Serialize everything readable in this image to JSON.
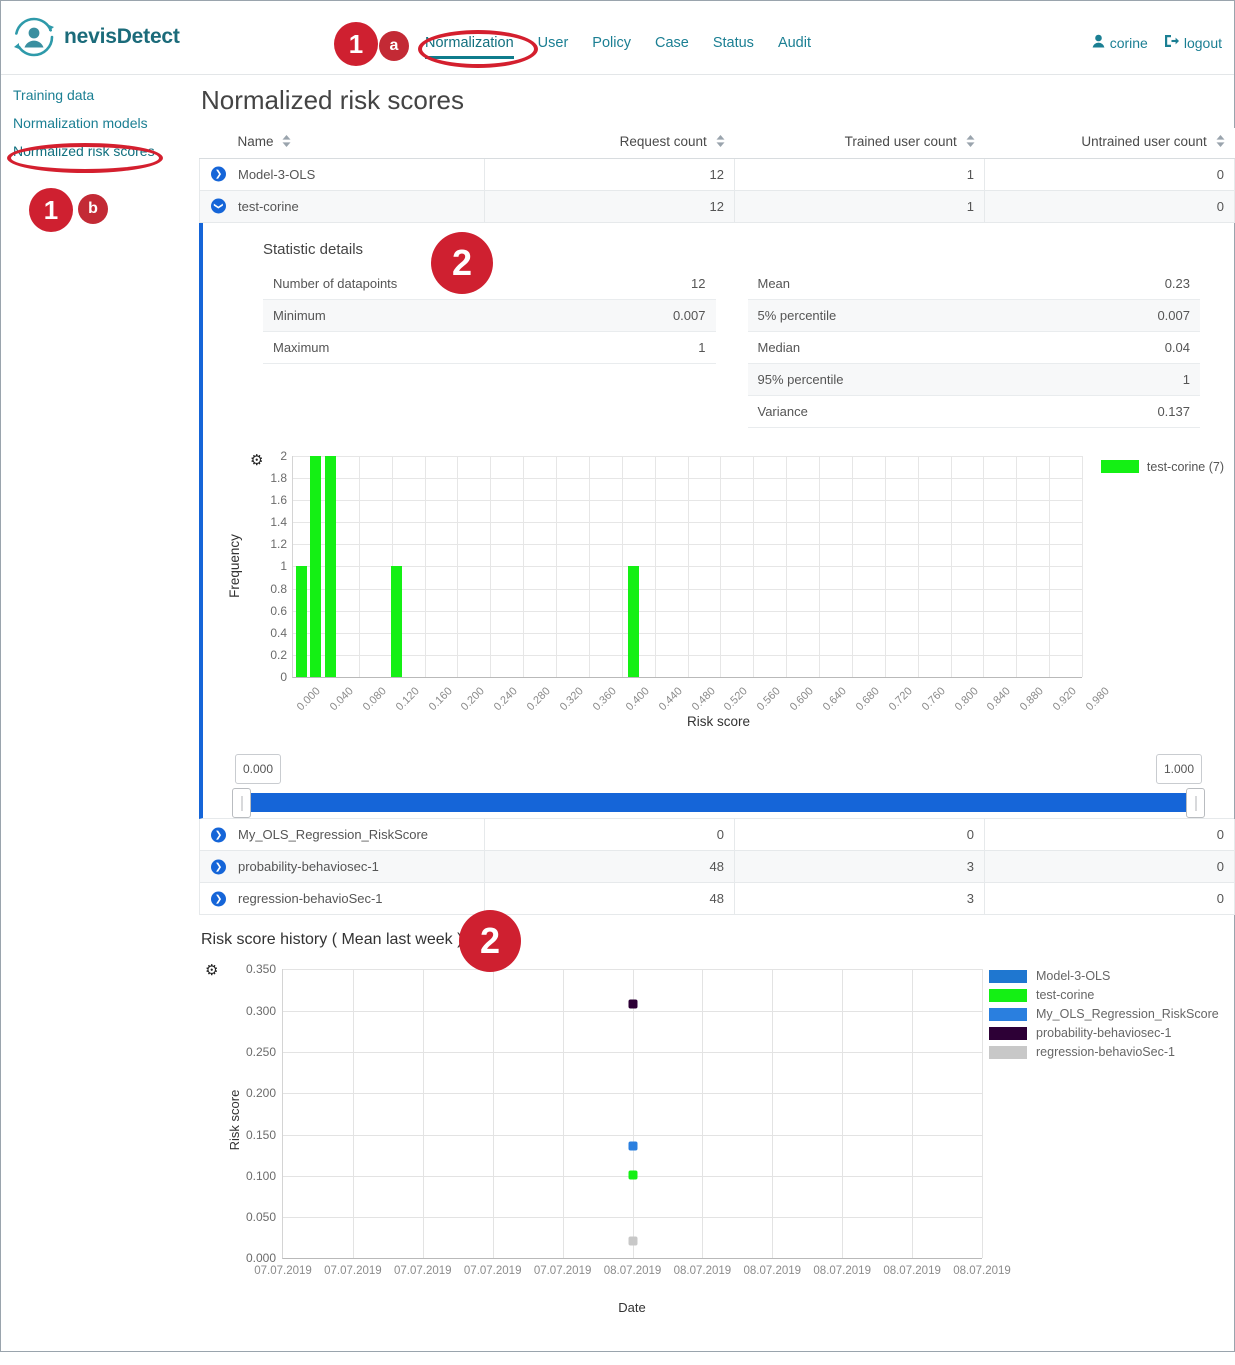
{
  "brand": {
    "name": "nevisDetect",
    "logo_icon": "user-circle-arrows-logo"
  },
  "topnav": {
    "items": [
      {
        "label": "Normalization",
        "active": true
      },
      {
        "label": "User",
        "active": false
      },
      {
        "label": "Policy",
        "active": false
      },
      {
        "label": "Case",
        "active": false
      },
      {
        "label": "Status",
        "active": false
      },
      {
        "label": "Audit",
        "active": false
      }
    ],
    "user": {
      "name": "corine",
      "icon": "user-icon"
    },
    "logout": {
      "label": "logout",
      "icon": "logout-icon"
    }
  },
  "sidebar": {
    "items": [
      {
        "label": "Training data",
        "active": false
      },
      {
        "label": "Normalization models",
        "active": false
      },
      {
        "label": "Normalized risk scores",
        "active": true
      }
    ]
  },
  "page": {
    "title": "Normalized risk scores"
  },
  "table": {
    "headers": [
      "Name",
      "Request count",
      "Trained user count",
      "Untrained user count"
    ],
    "rows": [
      {
        "name": "Model-3-OLS",
        "request_count": "12",
        "trained_user_count": "1",
        "untrained_user_count": "0",
        "expanded": false
      },
      {
        "name": "test-corine",
        "request_count": "12",
        "trained_user_count": "1",
        "untrained_user_count": "0",
        "expanded": true
      },
      {
        "name": "My_OLS_Regression_RiskScore",
        "request_count": "0",
        "trained_user_count": "0",
        "untrained_user_count": "0",
        "expanded": false
      },
      {
        "name": "probability-behaviosec-1",
        "request_count": "48",
        "trained_user_count": "3",
        "untrained_user_count": "0",
        "expanded": false
      },
      {
        "name": "regression-behavioSec-1",
        "request_count": "48",
        "trained_user_count": "3",
        "untrained_user_count": "0",
        "expanded": false
      }
    ]
  },
  "detail": {
    "title": "Statistic details",
    "left_stats": [
      {
        "key": "Number of datapoints",
        "value": "12"
      },
      {
        "key": "Minimum",
        "value": "0.007"
      },
      {
        "key": "Maximum",
        "value": "1"
      }
    ],
    "right_stats": [
      {
        "key": "Mean",
        "value": "0.23"
      },
      {
        "key": "5% percentile",
        "value": "0.007"
      },
      {
        "key": "Median",
        "value": "0.04"
      },
      {
        "key": "95% percentile",
        "value": "1"
      },
      {
        "key": "Variance",
        "value": "0.137"
      }
    ],
    "slider": {
      "min_value": "0.000",
      "max_value": "1.000"
    },
    "gear_icon": "gear-icon"
  },
  "history": {
    "title": "Risk score history ( Mean last week )",
    "gear_icon": "gear-icon"
  },
  "annotations": [
    {
      "label": "1",
      "kind": "big"
    },
    {
      "label": "a",
      "kind": "sm"
    },
    {
      "label": "1",
      "kind": "big"
    },
    {
      "label": "b",
      "kind": "sm"
    },
    {
      "label": "2",
      "kind": "huge"
    },
    {
      "label": "2",
      "kind": "huge"
    }
  ],
  "colors": {
    "brand_teal": "#1b7f93",
    "accent_blue": "#1565d8",
    "annotation_red": "#cf2030",
    "series_green": "#14f014",
    "series_blue": "#1f77d0",
    "series_purple": "#2d0036",
    "series_gray": "#c8c8c8"
  },
  "chart_data": [
    {
      "type": "bar",
      "title": "",
      "xlabel": "Risk score",
      "ylabel": "Frequency",
      "legend": [
        {
          "name": "test-corine (7)",
          "color": "#14f014"
        }
      ],
      "legend_position": "right",
      "grid": true,
      "xlim": [
        0.0,
        1.0
      ],
      "ylim": [
        0,
        2
      ],
      "ytick_labels": [
        "0",
        "0.2",
        "0.4",
        "0.6",
        "0.8",
        "1",
        "1.2",
        "1.4",
        "1.6",
        "1.8",
        "2"
      ],
      "ytick_values": [
        0,
        0.2,
        0.4,
        0.6,
        0.8,
        1,
        1.2,
        1.4,
        1.6,
        1.8,
        2
      ],
      "xtick_labels": [
        "0.000",
        "0.040",
        "0.080",
        "0.120",
        "0.160",
        "0.200",
        "0.240",
        "0.280",
        "0.320",
        "0.360",
        "0.400",
        "0.440",
        "0.480",
        "0.520",
        "0.560",
        "0.600",
        "0.640",
        "0.680",
        "0.720",
        "0.760",
        "0.800",
        "0.840",
        "0.880",
        "0.920",
        "0.980"
      ],
      "bins": [
        0.004,
        0.022,
        0.04,
        0.124,
        0.424
      ],
      "values": [
        1,
        2,
        2,
        1,
        1
      ]
    },
    {
      "type": "scatter",
      "title": "Risk score history ( Mean last week )",
      "xlabel": "Date",
      "ylabel": "Risk score",
      "grid": true,
      "ylim": [
        0.0,
        0.35
      ],
      "ytick_labels": [
        "0.000",
        "0.050",
        "0.100",
        "0.150",
        "0.200",
        "0.250",
        "0.300",
        "0.350"
      ],
      "ytick_values": [
        0.0,
        0.05,
        0.1,
        0.15,
        0.2,
        0.25,
        0.3,
        0.35
      ],
      "xtick_labels": [
        "07.07.2019",
        "07.07.2019",
        "07.07.2019",
        "07.07.2019",
        "07.07.2019",
        "08.07.2019",
        "08.07.2019",
        "08.07.2019",
        "08.07.2019",
        "08.07.2019",
        "08.07.2019"
      ],
      "legend_position": "right",
      "series": [
        {
          "name": "Model-3-OLS",
          "color": "#1f77d0",
          "points": []
        },
        {
          "name": "test-corine",
          "color": "#14f014",
          "points": [
            {
              "x": 5,
              "y": 0.101
            }
          ]
        },
        {
          "name": "My_OLS_Regression_RiskScore",
          "color": "#2a7fdf",
          "points": [
            {
              "x": 5,
              "y": 0.136
            }
          ]
        },
        {
          "name": "probability-behaviosec-1",
          "color": "#2d0036",
          "points": [
            {
              "x": 5,
              "y": 0.308
            }
          ]
        },
        {
          "name": "regression-behavioSec-1",
          "color": "#c8c8c8",
          "points": [
            {
              "x": 5,
              "y": 0.021
            }
          ]
        }
      ]
    }
  ]
}
